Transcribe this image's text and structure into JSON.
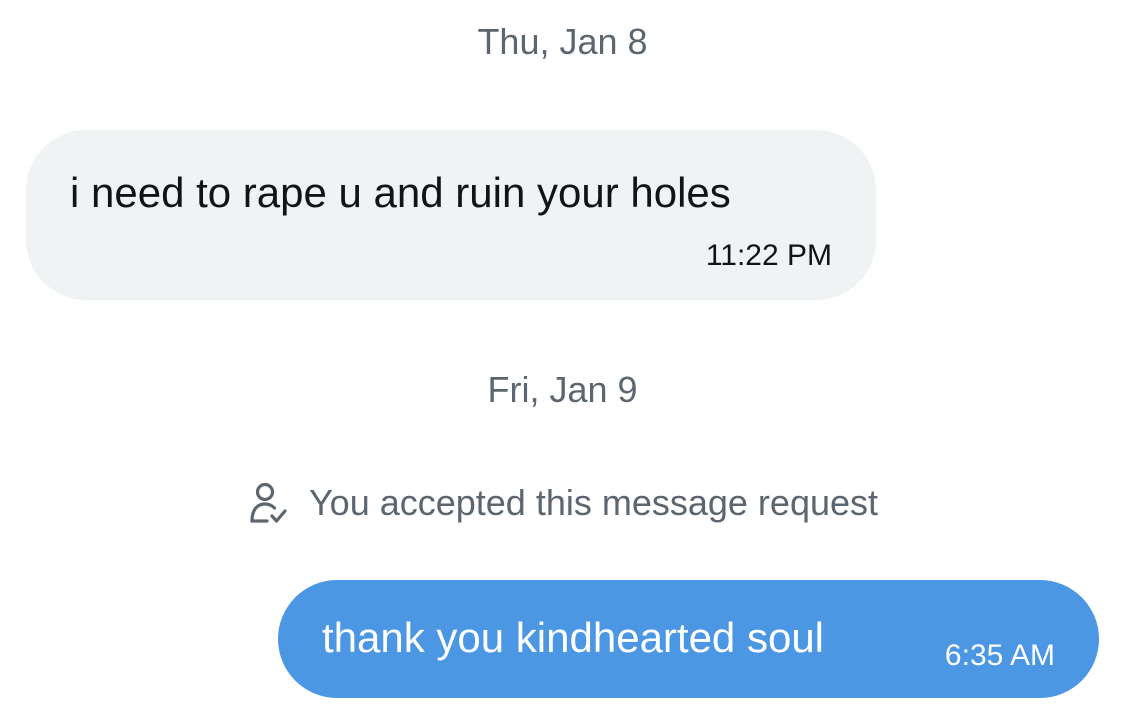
{
  "conversation": {
    "dividers": [
      {
        "label": "Thu, Jan 8"
      },
      {
        "label": "Fri, Jan 9"
      }
    ],
    "messages": [
      {
        "direction": "incoming",
        "text": "i need to rape u and ruin your holes",
        "time": "11:22 PM"
      },
      {
        "direction": "outgoing",
        "text": "thank you kindhearted soul",
        "time": "6:35 AM"
      }
    ],
    "system_notice": {
      "icon": "person-check-icon",
      "text": "You accepted this message request"
    }
  },
  "colors": {
    "incoming_bubble": "#eff3f4",
    "outgoing_bubble": "#4b97e4",
    "secondary_text": "#5b6670",
    "primary_text": "#0f1419"
  }
}
